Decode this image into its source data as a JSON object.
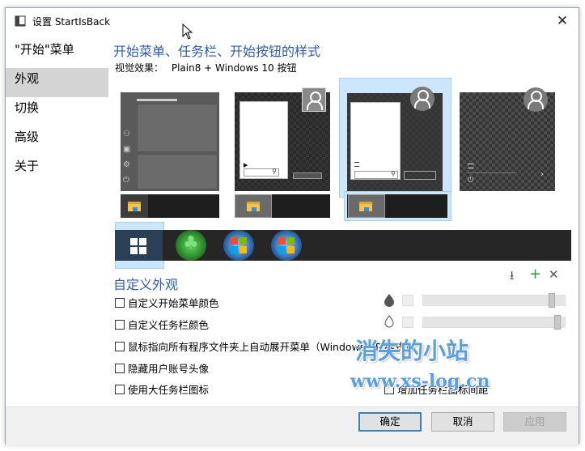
{
  "window": {
    "title": "设置 StartIsBack",
    "close_glyph": "✕"
  },
  "sidebar": {
    "items": [
      {
        "label": "\"开始\"菜单"
      },
      {
        "label": "外观"
      },
      {
        "label": "切换"
      },
      {
        "label": "高级"
      },
      {
        "label": "关于"
      }
    ],
    "active_index": 1
  },
  "appearance": {
    "heading": "开始菜单、任务栏、开始按钮的样式",
    "visual_effect_label": "视觉效果：",
    "visual_effect_value": "Plain8 + Windows 10 按钮",
    "custom_heading": "自定义外观",
    "options": [
      {
        "label": "自定义开始菜单颜色",
        "checked": false
      },
      {
        "label": "自定义任务栏颜色",
        "checked": false
      },
      {
        "label": "鼠标指向所有程序文件夹上自动展开菜单（Windows XP 样式）",
        "checked": false
      },
      {
        "label": "隐藏用户账号头像",
        "checked": false
      },
      {
        "label": "使用大任务栏图标",
        "checked": false
      }
    ],
    "taskbar_margin_option": "增加任务栏图标间距",
    "toolbar_icons": [
      "download-icon",
      "plus-icon",
      "close-icon"
    ],
    "toolbar_glyphs": {
      "download": "⭳",
      "plus": "+",
      "close": "✕"
    },
    "sliders": [
      {
        "icon": "opacity-drop-filled-icon",
        "glyph": "💧",
        "level": 0.93
      },
      {
        "icon": "opacity-drop-outline-icon",
        "glyph": "💧",
        "level": 0.97
      }
    ]
  },
  "watermark": {
    "line1": "消失的小站",
    "line2": "www.xs-log.cn"
  },
  "footer": {
    "ok": "确定",
    "cancel": "取消",
    "apply": "应用"
  },
  "colors": {
    "accent": "#2a5cb4",
    "selection": "#cde6fb",
    "taskbar": "#262626"
  }
}
